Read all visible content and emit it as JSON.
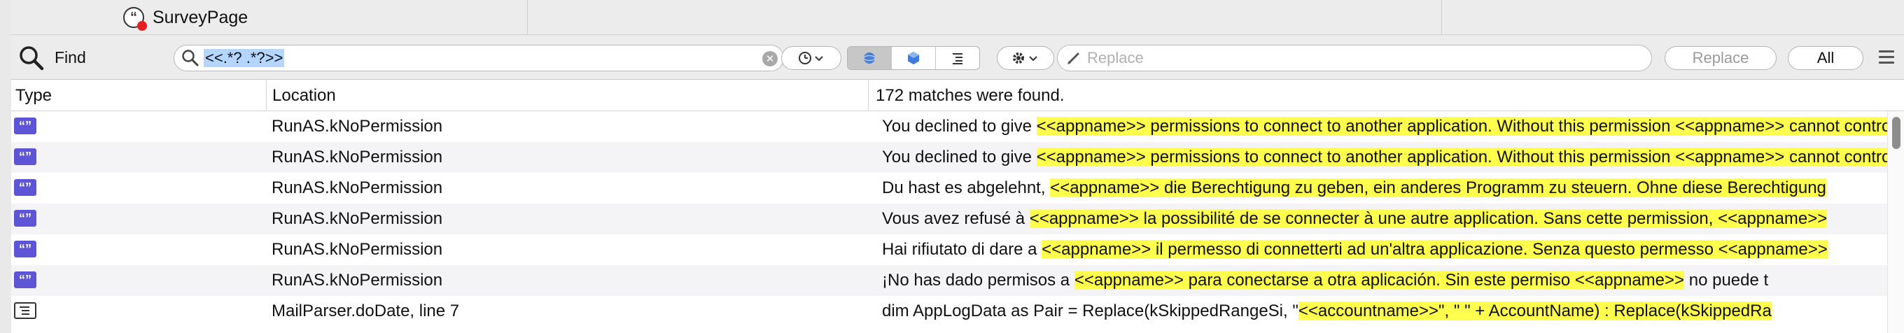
{
  "tabs": [
    {
      "label": "SurveyPage",
      "icon": "string-constant-icon",
      "active": true
    },
    {
      "label": ""
    }
  ],
  "toolbar": {
    "find_label": "Find",
    "search_value": "<<.*? .*?>>",
    "replace_placeholder": "Replace",
    "replace_button": "Replace",
    "all_button": "All"
  },
  "columns": {
    "type": "Type",
    "location": "Location",
    "summary": "172 matches were found."
  },
  "rows": [
    {
      "icon": "string-icon",
      "location": "RunAS.kNoPermission",
      "pre": "You declined to give ",
      "match": "<<appname>> permissions to connect to another application. Without this permission <<appname>> cannot control it",
      "post": ""
    },
    {
      "icon": "string-icon",
      "location": "RunAS.kNoPermission",
      "pre": "You declined to give ",
      "match": "<<appname>> permissions to connect to another application. Without this permission <<appname>> cannot control it",
      "post": ""
    },
    {
      "icon": "string-icon",
      "location": "RunAS.kNoPermission",
      "pre": "Du hast es abgelehnt, ",
      "match": "<<appname>> die Berechtigung zu geben, ein anderes Programm zu steuern. Ohne diese Berechtigung",
      "post": ""
    },
    {
      "icon": "string-icon",
      "location": "RunAS.kNoPermission",
      "pre": "Vous avez refusé à ",
      "match": "<<appname>> la possibilité de se connecter à une autre application. Sans cette permission, <<appname>>",
      "post": ""
    },
    {
      "icon": "string-icon",
      "location": "RunAS.kNoPermission",
      "pre": "Hai rifiutato di dare a ",
      "match": "<<appname>> il permesso di connetterti ad un'altra applicazione. Senza questo permesso <<appname>>",
      "post": ""
    },
    {
      "icon": "string-icon",
      "location": "RunAS.kNoPermission",
      "pre": "¡No has dado permisos a ",
      "match": "<<appname>> para conectarse a otra aplicación. Sin este permiso <<appname>>",
      "post": " no puede t"
    },
    {
      "icon": "method-icon",
      "location": "MailParser.doDate, line 7",
      "pre": "dim AppLogData as Pair = Replace(kSkippedRangeSi, \"",
      "match": "<<accountname>>\", \" \" + AccountName) : Replace(kSkippedRa",
      "post": ""
    }
  ],
  "colors": {
    "highlight": "#ffff4d",
    "string_icon": "#5d54d6",
    "selection": "#b4d5fe"
  }
}
